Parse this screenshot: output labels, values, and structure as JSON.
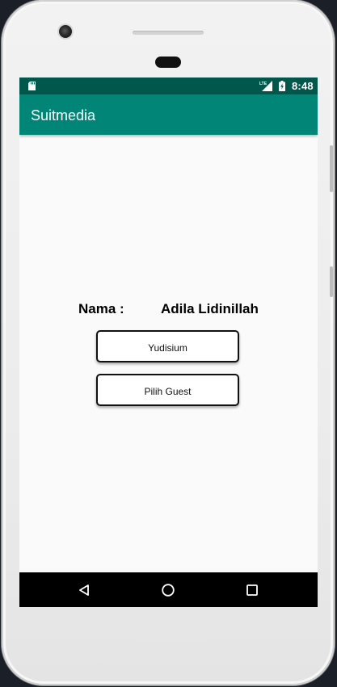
{
  "status_bar": {
    "time": "8:48",
    "network_label": "LTE",
    "icons": [
      "sd-card-icon",
      "lte-signal-icon",
      "battery-charging-icon"
    ],
    "color": "#00574b"
  },
  "app_bar": {
    "title": "Suitmedia",
    "color": "#008577"
  },
  "main": {
    "name_label": "Nama :",
    "name_value": "Adila Lidinillah",
    "buttons": [
      {
        "label": "Yudisium"
      },
      {
        "label": "Pilih Guest"
      }
    ]
  },
  "nav_bar": {
    "buttons": [
      "back-icon",
      "home-icon",
      "recents-icon"
    ]
  }
}
